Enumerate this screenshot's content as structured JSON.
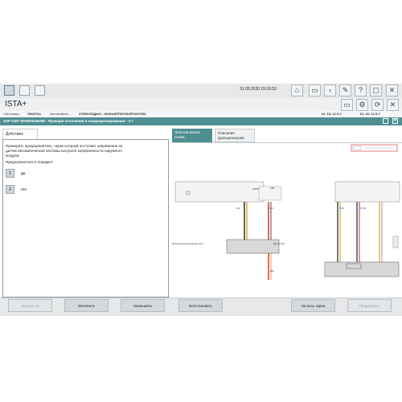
{
  "toolbar": {
    "datetime": "31.05.2020 15:18:53"
  },
  "app": {
    "title": "ISTA+"
  },
  "vehicle": {
    "vin_label": "VIN-номер:",
    "vin_value": "VB40764",
    "car_label": "Автомобиль:",
    "car_value": "3'/E90/СЕДАН/ - /N46/АКПП/ECE/ЛР/2007/06",
    "kl15": "KL 15:  12.5 V",
    "kl30": "KL 30:  12.5 V"
  },
  "ssp": {
    "title": "SSP-SSP-SP0000026286 - Функция отопления и кондиционирования - V.7"
  },
  "left": {
    "tab": "Действие",
    "question_text": "Проверить предохранитель, через который поступает напряжение на датчик автоматической системы контроля загрязненности наружного воздуха.",
    "question": "Предохранитель в порядке?",
    "answers": [
      {
        "num": "1",
        "label": "Да"
      },
      {
        "num": "2",
        "label": "Нет"
      }
    ]
  },
  "right": {
    "tabs": [
      "Электрическая схема",
      "Описание функционирова"
    ],
    "diagram": {
      "labels": [
        "F83",
        "5/20",
        "A262",
        "K600r",
        "T9A5",
        "B-TBA",
        "1",
        "5",
        "A/C1",
        "NOTE",
        "B50"
      ],
      "module1": "Дополнительный водяной насос",
      "module2": "Датчик AUC"
    }
  },
  "footer": {
    "back": "Вернуться",
    "zoom_in": "Увеличить",
    "zoom_out": "Уменьшить",
    "fit": "Восстановить",
    "fullscreen": "На весь экран",
    "next": "Продолжить",
    "hidden": "Возврат"
  }
}
